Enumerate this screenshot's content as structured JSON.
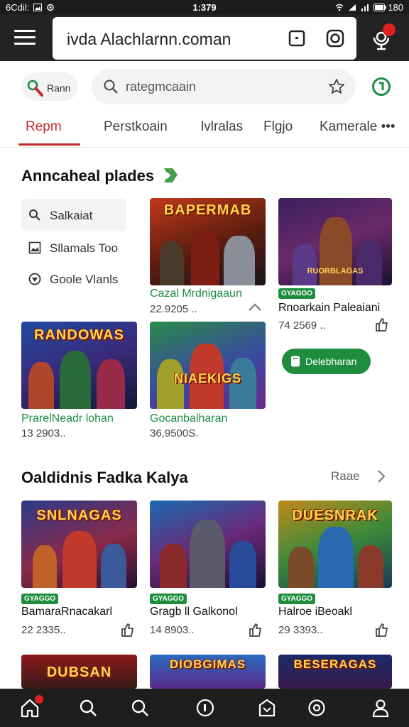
{
  "status_bar": {
    "left_text": "6Cdil:",
    "time": "1:379",
    "battery": "180"
  },
  "address_bar": {
    "url": "ivda Alachlarnn.coman"
  },
  "search": {
    "pill_label": "Rann",
    "placeholder": "rategmcaain"
  },
  "tabs": [
    {
      "label": "Repm"
    },
    {
      "label": "Perstkoain"
    },
    {
      "label": "lvlralas"
    },
    {
      "label": "Flgjo"
    },
    {
      "label": "Kamerale •••"
    }
  ],
  "section1": {
    "title": "Anncaheal plades",
    "filters": [
      {
        "label": "Salkaiat",
        "icon": "search-icon"
      },
      {
        "label": "Sllamals Too",
        "icon": "image-icon"
      },
      {
        "label": "Goole Vlanls",
        "icon": "shield-icon"
      }
    ],
    "cards": [
      {
        "art_title": "BAPERMAB",
        "art_sub": "",
        "title": "Cazal Mrdnigaaun",
        "meta": "22.9205 ..",
        "badge": ""
      },
      {
        "art_title": "",
        "art_sub": "RUORBLAGAS",
        "title": "Rnoarkain Paleaiani",
        "meta": "74 2569 ..",
        "badge": "GYAGGO"
      },
      {
        "art_title": "RANDOWAS",
        "art_sub": "",
        "title": "PrarelNeadr lohan",
        "meta": "13 2903..",
        "badge": ""
      },
      {
        "art_title": "NIAEKIGS",
        "art_sub": "",
        "title": "Gocanbalharan",
        "meta": "36,9500S.",
        "badge": ""
      }
    ],
    "install_label": "Delebharan"
  },
  "section2": {
    "title": "Oaldidnis Fadka Kalya",
    "see_more": "Raae",
    "cards": [
      {
        "art_title": "SNLNAGAS",
        "title": "BamaraRnacakarl",
        "meta": "22 2335..",
        "badge": "GYAGGO"
      },
      {
        "art_title": "",
        "title": "Gragb ll Galkonol",
        "meta": "14 8903..",
        "badge": "GYAGGO"
      },
      {
        "art_title": "DUESNRAK",
        "title": "Halroe iBeoakl",
        "meta": "29 3393..",
        "badge": "GYAGGO"
      }
    ]
  },
  "section3": {
    "cards": [
      {
        "art_title": "DUBSAN"
      },
      {
        "art_title": "DIOBGIMAS"
      },
      {
        "art_title": "BESERAGAS"
      }
    ]
  },
  "colors": {
    "accent_green": "#1e8e3e",
    "accent_red": "#c62828",
    "bar_dark": "#232323"
  }
}
